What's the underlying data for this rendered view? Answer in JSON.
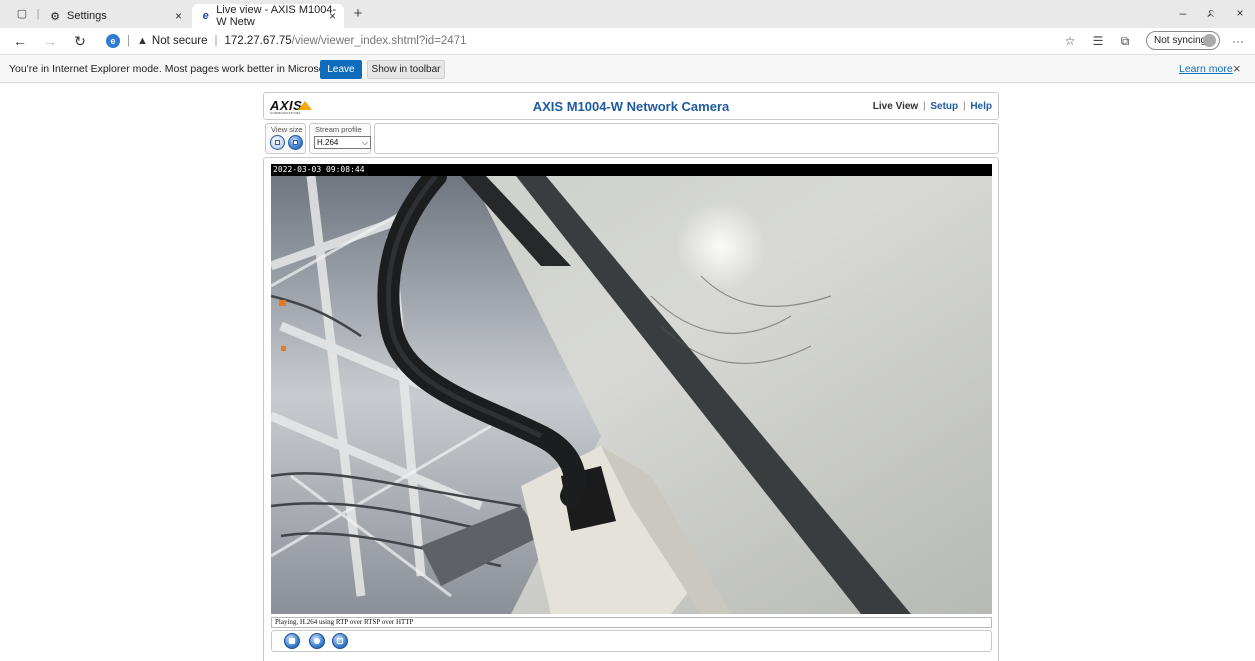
{
  "browser": {
    "tabs": [
      {
        "label": "Settings",
        "icon": "gear-icon",
        "active": false
      },
      {
        "label": "Live view - AXIS M1004-W Netw",
        "icon": "ie-icon",
        "active": true
      }
    ],
    "new_tab_symbol": "+",
    "window_controls": {
      "minimize": "–",
      "restore": "ᨅ",
      "close": "×"
    },
    "address": {
      "security": "Not secure",
      "host": "172.27.67.75",
      "path": "/view/viewer_index.shtml?id=2471"
    },
    "sync_label": "Not syncing",
    "more_symbol": "···"
  },
  "ie_mode_bar": {
    "message": "You're in Internet Explorer mode. Most pages work better in Microsoft Edge.",
    "leave_label": "Leave",
    "show_toolbar_label": "Show in toolbar",
    "learn_more_label": "Learn more",
    "close_symbol": "×"
  },
  "camera_page": {
    "logo_text": "AXIS",
    "logo_subtext": "COMMUNICATIONS",
    "title": "AXIS M1004-W Network Camera",
    "nav": {
      "live_view": "Live View",
      "setup": "Setup",
      "help": "Help",
      "separator": "|"
    },
    "view_size_label": "View size",
    "stream_profile_label": "Stream profile",
    "stream_profile_value": "H.264",
    "timestamp": "2022-03-03 09:08:44",
    "status_text": "Playing, H.264 using RTP over RTSP over HTTP"
  },
  "colors": {
    "accent_blue": "#1e5a9e",
    "edge_blue": "#0f6cbd",
    "axis_yellow": "#f2a900"
  }
}
